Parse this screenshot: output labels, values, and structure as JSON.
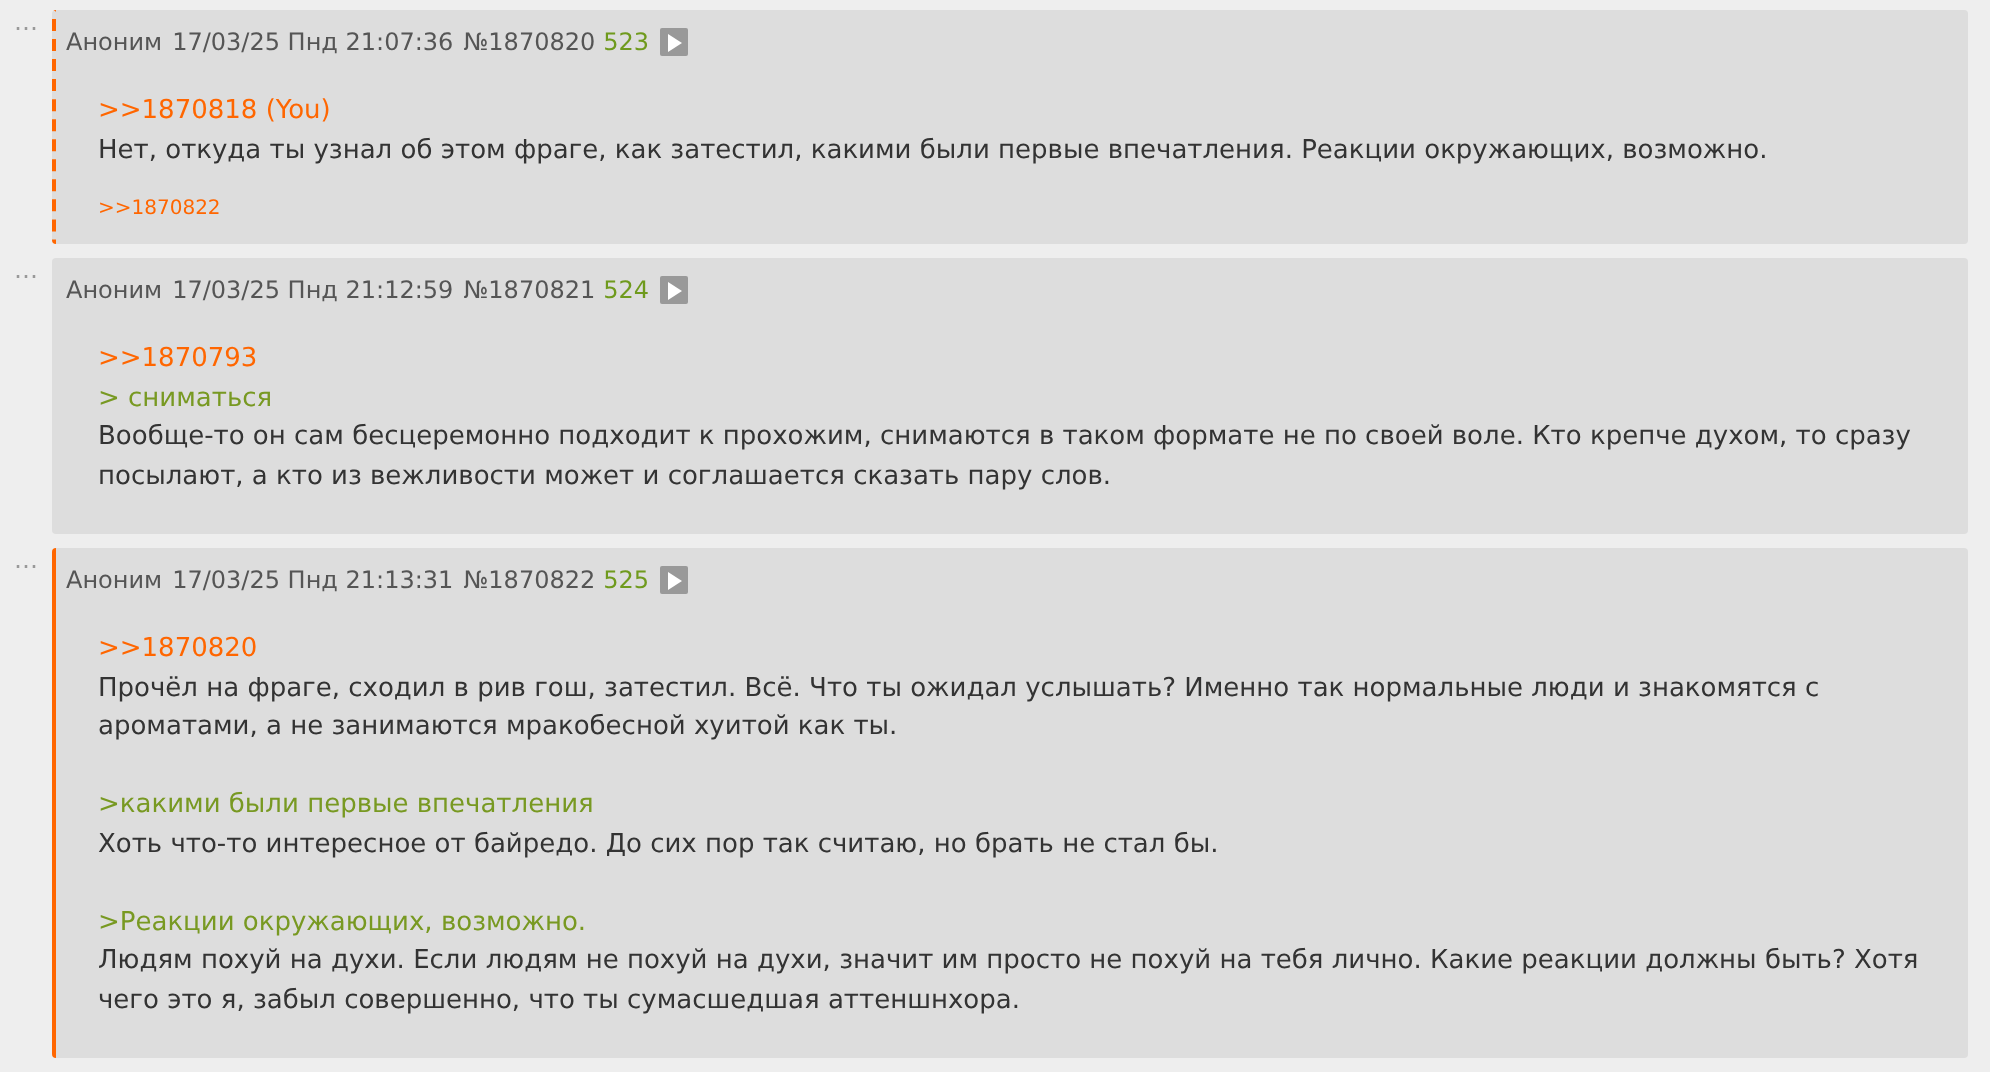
{
  "posts": [
    {
      "menu": "⋯",
      "reply_to_you": true,
      "highlighted": false,
      "name": "Аноним",
      "date": "17/03/25 Пнд 21:07:36",
      "number": "№1870820",
      "count": "523",
      "paragraphs": [
        [
          {
            "kind": "reply",
            "text": ">>1870818 (You)"
          },
          {
            "kind": "text",
            "text": "Нет, откуда ты узнал об этом фраге, как затестил, какими были первые впечатления. Реакции окружающих, возможно."
          }
        ]
      ],
      "backlinks": [
        ">>1870822"
      ]
    },
    {
      "menu": "⋯",
      "reply_to_you": false,
      "highlighted": false,
      "name": "Аноним",
      "date": "17/03/25 Пнд 21:12:59",
      "number": "№1870821",
      "count": "524",
      "paragraphs": [
        [
          {
            "kind": "reply",
            "text": ">>1870793"
          },
          {
            "kind": "quote",
            "text": "> сниматься"
          },
          {
            "kind": "text",
            "text": "Вообще-то он сам бесцеремонно подходит к прохожим, снимаются в таком формате не по своей воле. Кто крепче духом, то сразу посылают, а кто из вежливости может и соглашается сказать пару слов."
          }
        ]
      ]
    },
    {
      "menu": "⋯",
      "reply_to_you": false,
      "highlighted": true,
      "name": "Аноним",
      "date": "17/03/25 Пнд 21:13:31",
      "number": "№1870822",
      "count": "525",
      "paragraphs": [
        [
          {
            "kind": "reply",
            "text": ">>1870820"
          },
          {
            "kind": "text",
            "text": "Прочёл на фраге, сходил в рив гош, затестил. Всё. Что ты ожидал услышать? Именно так нормальные люди и знакомятся с ароматами, а не занимаются мракобесной хуитой как ты."
          }
        ],
        [
          {
            "kind": "quote",
            "text": ">какими были первые впечатления"
          },
          {
            "kind": "text",
            "text": "Хоть что-то интересное от байредо. До сих пор так считаю, но брать не стал бы."
          }
        ],
        [
          {
            "kind": "quote",
            "text": ">Реакции окружающих, возможно."
          },
          {
            "kind": "text",
            "text": "Людям похуй на духи. Если людям не похуй на духи, значит им просто не похуй на тебя лично. Какие реакции должны быть? Хотя чего это я, забыл совершенно, что ты сумасшедшая аттеншнхора."
          }
        ]
      ]
    }
  ]
}
